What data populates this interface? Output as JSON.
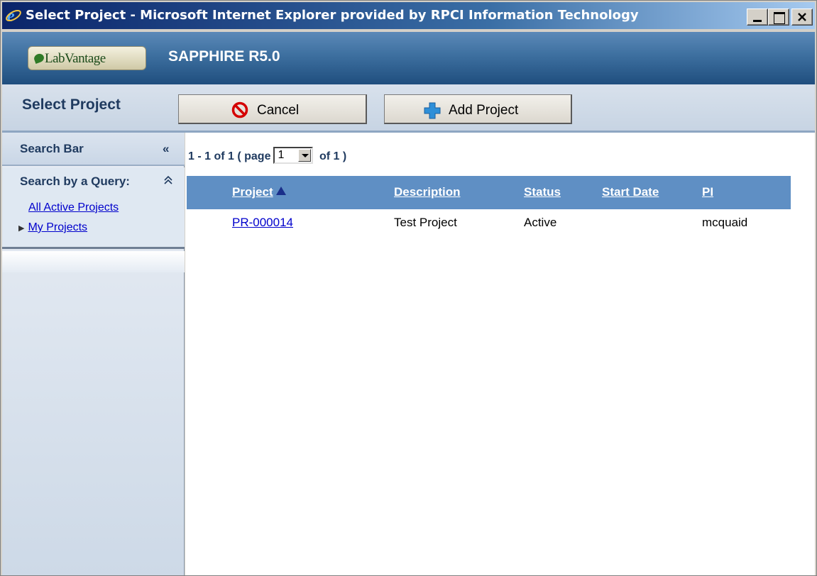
{
  "window": {
    "title": "Select Project - Microsoft Internet Explorer provided by RPCI Information Technology"
  },
  "app": {
    "logo_text": "LabVantage",
    "title": "SAPPHIRE R5.0"
  },
  "toolbar": {
    "heading": "Select Project",
    "cancel_label": "Cancel",
    "add_label": "Add Project"
  },
  "sidebar": {
    "title": "Search Bar",
    "query_title": "Search by a Query:",
    "links": [
      {
        "label": "All Active Projects"
      },
      {
        "label": "My Projects"
      }
    ]
  },
  "pager": {
    "range": "1 - 1 of 1",
    "page_prefix": "( page",
    "current_page": "1",
    "page_suffix": "of 1 )"
  },
  "grid": {
    "columns": [
      "Project",
      "Description",
      "Status",
      "Start Date",
      "PI"
    ],
    "rows": [
      {
        "project": "PR-000014",
        "description": "Test Project",
        "status": "Active",
        "start_date": "",
        "pi": "mcquaid"
      }
    ]
  },
  "colors": {
    "grid_header": "#5f8fc4",
    "link": "#0000cc",
    "app_header": "#3d6f9f"
  }
}
